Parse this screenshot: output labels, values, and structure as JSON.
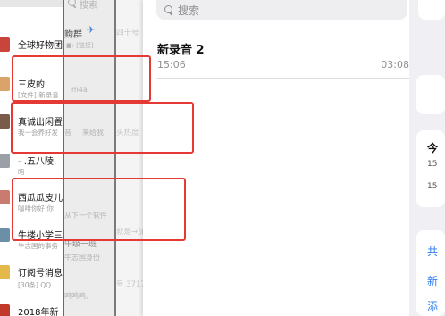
{
  "chat_list": {
    "items": [
      {
        "title": "全球好物团"
      },
      {
        "title": "三皮的",
        "subtitle": "[文件] 新录音"
      },
      {
        "title": "真诚出闲置",
        "subtitle": "我一会养好发"
      },
      {
        "title": "- .五八陵.",
        "subtitle": "晤"
      },
      {
        "title": "西瓜瓜皮儿",
        "subtitle": "咖啡你好 你"
      },
      {
        "title": "牛楼小学三",
        "subtitle": "牛志国的事务"
      },
      {
        "title": "订阅号消息",
        "subtitle": "[30条] QQ"
      },
      {
        "title": "2018年新"
      }
    ]
  },
  "middle_panel": {
    "search_label": "搜索",
    "fragments": [
      "购群",
      "■: [链接]",
      "m4a",
      "音",
      "来给我",
      "从下一个软件",
      "午级一班",
      "牛志国身份",
      "鸣鸣鸣,"
    ]
  },
  "back_panel": {
    "fragments": [
      "四十号",
      "头热度",
      "就是→加",
      "号 37172"
    ]
  },
  "recordings": {
    "search_placeholder": "搜索",
    "items": [
      {
        "title": "新录音 2",
        "time": "15:06",
        "duration": "03:08"
      }
    ]
  },
  "side_panel": {
    "labels": [
      "今",
      "15",
      "15"
    ],
    "links": [
      "共",
      "新",
      "添"
    ],
    "link_color": "#2f7ff0"
  },
  "icons": {
    "search": "search-icon",
    "send": "airplane-icon"
  },
  "annotations": {
    "color": "#e53935"
  }
}
